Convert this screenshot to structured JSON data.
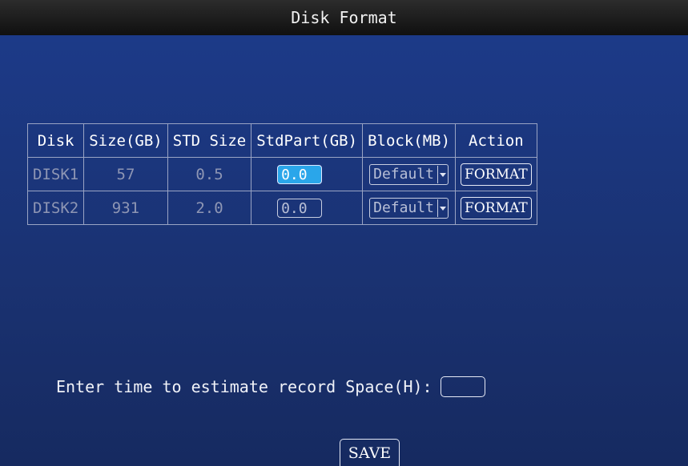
{
  "window": {
    "title": "Disk Format"
  },
  "table": {
    "headers": [
      "Disk",
      "Size(GB)",
      "STD Size",
      "StdPart(GB)",
      "Block(MB)",
      "Action"
    ],
    "rows": [
      {
        "disk": "DISK1",
        "size": "57",
        "std_size": "0.5",
        "stdpart": "0.0",
        "block": "Default",
        "action": "FORMAT"
      },
      {
        "disk": "DISK2",
        "size": "931",
        "std_size": "2.0",
        "stdpart": "0.0",
        "block": "Default",
        "action": "FORMAT"
      }
    ]
  },
  "estimate": {
    "label": "Enter time to estimate record Space(H):",
    "value": ""
  },
  "save_label": "SAVE",
  "colors": {
    "background": "#1b3475",
    "focus": "#2aa6ea",
    "titlebar": "#1a1a1a"
  },
  "icons": {
    "select_arrow": "dropdown-arrow-icon"
  }
}
